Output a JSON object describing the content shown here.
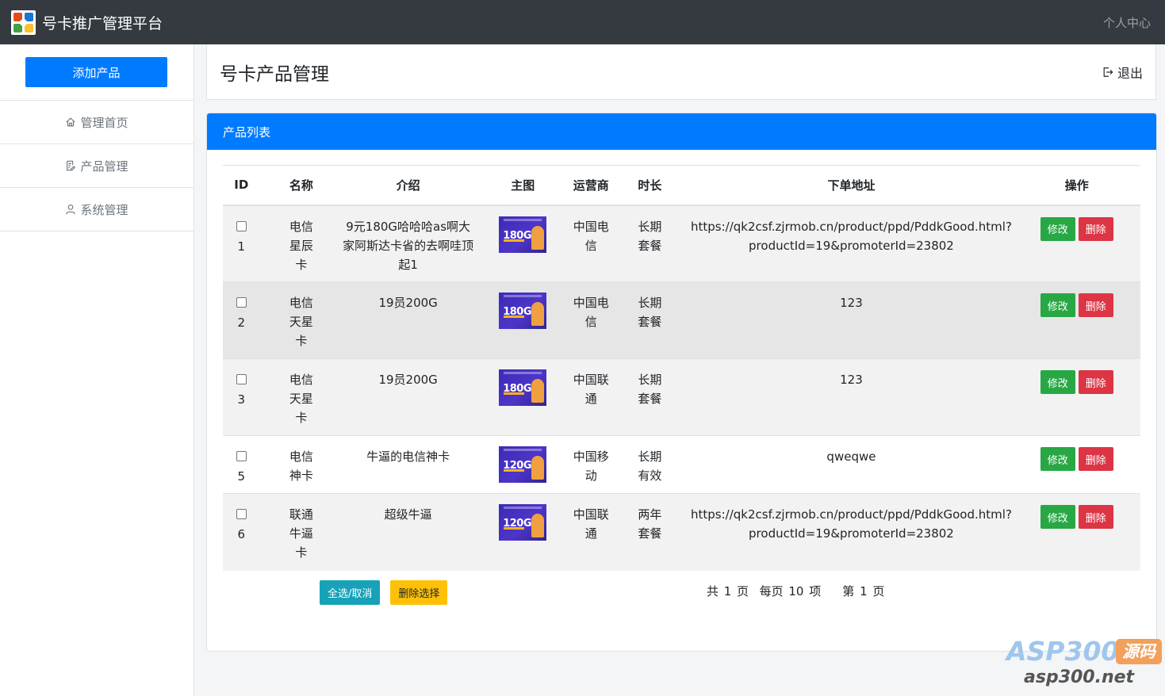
{
  "app": {
    "title": "号卡推广管理平台",
    "user_center": "个人中心"
  },
  "sidebar": {
    "add_button": "添加产品",
    "items": [
      {
        "label": "管理首页",
        "icon": "home-icon"
      },
      {
        "label": "产品管理",
        "icon": "document-edit-icon"
      },
      {
        "label": "系统管理",
        "icon": "user-icon"
      }
    ]
  },
  "page": {
    "title": "号卡产品管理",
    "logout": "退出"
  },
  "card": {
    "title": "产品列表"
  },
  "table": {
    "headers": {
      "id": "ID",
      "name": "名称",
      "intro": "介绍",
      "image": "主图",
      "carrier": "运营商",
      "duration": "时长",
      "url": "下单地址",
      "ops": "操作"
    },
    "rows": [
      {
        "id": "1",
        "name": "电信星辰卡",
        "intro": "9元180G哈哈哈as啊大家阿斯达卡省的去啊哇顶起1",
        "image_text": "180G",
        "carrier": "中国电信",
        "duration": "长期套餐",
        "url": "https://qk2csf.zjrmob.cn/product/ppd/PddkGood.html?productId=19&promoterId=23802"
      },
      {
        "id": "2",
        "name": "电信天星卡",
        "intro": "19员200G",
        "image_text": "180G",
        "carrier": "中国电信",
        "duration": "长期套餐",
        "url": "123"
      },
      {
        "id": "3",
        "name": "电信天星卡",
        "intro": "19员200G",
        "image_text": "180G",
        "carrier": "中国联通",
        "duration": "长期套餐",
        "url": "123"
      },
      {
        "id": "5",
        "name": "电信神卡",
        "intro": "牛逼的电信神卡",
        "image_text": "120G",
        "carrier": "中国移动",
        "duration": "长期有效",
        "url": "qweqwe"
      },
      {
        "id": "6",
        "name": "联通牛逼卡",
        "intro": "超级牛逼",
        "image_text": "120G",
        "carrier": "中国联通",
        "duration": "两年套餐",
        "url": "https://qk2csf.zjrmob.cn/product/ppd/PddkGood.html?productId=19&promoterId=23802"
      }
    ],
    "edit_label": "修改",
    "delete_label": "删除"
  },
  "footer": {
    "select_all": "全选/取消",
    "delete_selected": "删除选择",
    "pager": "共 1 页  每页 10 项    第 1 页"
  },
  "watermark": {
    "brand": "ASP300",
    "badge": "源码",
    "domain": "asp300.net"
  }
}
